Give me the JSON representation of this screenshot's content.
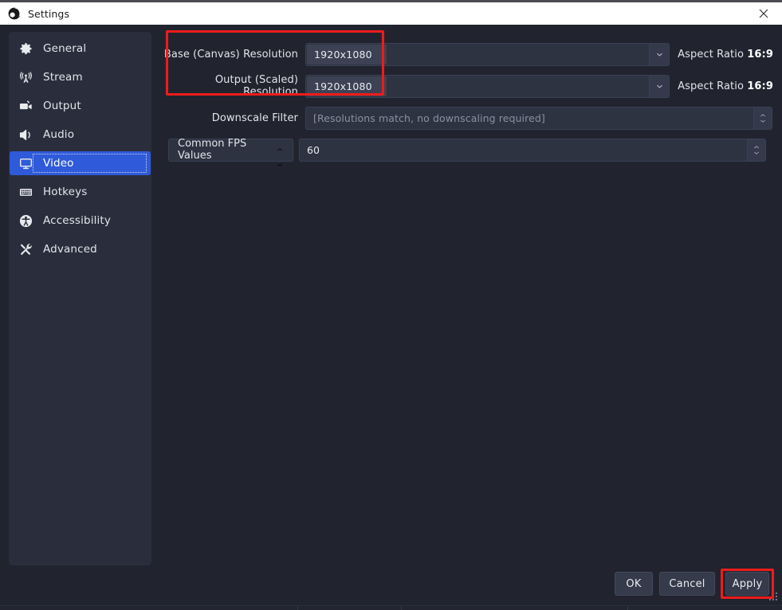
{
  "window": {
    "title": "Settings",
    "logo_icon": "obs-logo-icon",
    "close_icon": "close-icon"
  },
  "sidebar": {
    "items": [
      {
        "label": "General",
        "icon": "gear-icon",
        "selected": false
      },
      {
        "label": "Stream",
        "icon": "broadcast-icon",
        "selected": false
      },
      {
        "label": "Output",
        "icon": "video-camera-icon",
        "selected": false
      },
      {
        "label": "Audio",
        "icon": "speaker-icon",
        "selected": false
      },
      {
        "label": "Video",
        "icon": "monitor-icon",
        "selected": true
      },
      {
        "label": "Hotkeys",
        "icon": "keyboard-icon",
        "selected": false
      },
      {
        "label": "Accessibility",
        "icon": "accessibility-icon",
        "selected": false
      },
      {
        "label": "Advanced",
        "icon": "tools-icon",
        "selected": false
      }
    ]
  },
  "video_settings": {
    "base_resolution": {
      "label": "Base (Canvas) Resolution",
      "value": "1920x1080",
      "aspect_prefix": "Aspect Ratio",
      "aspect_value": "16:9",
      "arrow_icon": "chevron-down-icon"
    },
    "output_resolution": {
      "label": "Output (Scaled) Resolution",
      "value": "1920x1080",
      "aspect_prefix": "Aspect Ratio",
      "aspect_value": "16:9",
      "arrow_icon": "chevron-down-icon"
    },
    "downscale_filter": {
      "label": "Downscale Filter",
      "value": "[Resolutions match, no downscaling required]",
      "spinner_icon": "updown-spinner-icon"
    },
    "fps": {
      "mode_label": "Common FPS Values",
      "value": "60",
      "spinner_icon": "updown-spinner-icon"
    }
  },
  "footer": {
    "ok_label": "OK",
    "cancel_label": "Cancel",
    "apply_label": "Apply"
  },
  "annotations": {
    "resolution_highlight_color": "#ee1c1c",
    "apply_highlight_color": "#ee1c1c"
  }
}
